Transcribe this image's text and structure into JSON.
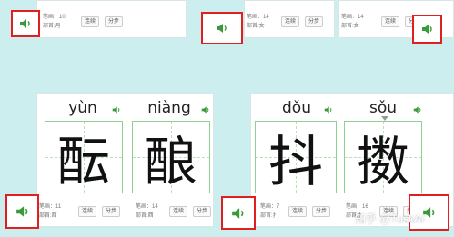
{
  "accent_color": "#3a9a3a",
  "highlight_color": "#e02020",
  "speaker_icon": "speaker-icon",
  "top_cards": [
    {
      "strokes_label": "笔画：10",
      "radical_label": "部首:月",
      "continue_btn": "连续",
      "step_btn": "分步"
    },
    {
      "strokes_label": "笔画：14",
      "radical_label": "部首:女",
      "continue_btn": "连续",
      "step_btn": "分步"
    },
    {
      "strokes_label": "笔画：14",
      "radical_label": "部首:女",
      "continue_btn": "连续",
      "step_btn": "分步"
    }
  ],
  "cards": [
    {
      "pinyin": "yùn",
      "character": "酝",
      "strokes_label": "笔画：11",
      "radical_label": "部首:酉",
      "continue_btn": "连续",
      "step_btn": "分步"
    },
    {
      "pinyin": "niàng",
      "character": "酿",
      "strokes_label": "笔画：14",
      "radical_label": "部首:酉",
      "continue_btn": "连续",
      "step_btn": "分步"
    },
    {
      "pinyin": "dǒu",
      "character": "抖",
      "strokes_label": "笔画：7",
      "radical_label": "部首:扌",
      "continue_btn": "连续",
      "step_btn": "分步"
    },
    {
      "pinyin": "sǒu",
      "character": "擞",
      "strokes_label": "笔画：16",
      "radical_label": "部首:扌",
      "continue_btn": "连续",
      "step_btn": "分步"
    }
  ],
  "watermark": "知乎 @TuskAI"
}
